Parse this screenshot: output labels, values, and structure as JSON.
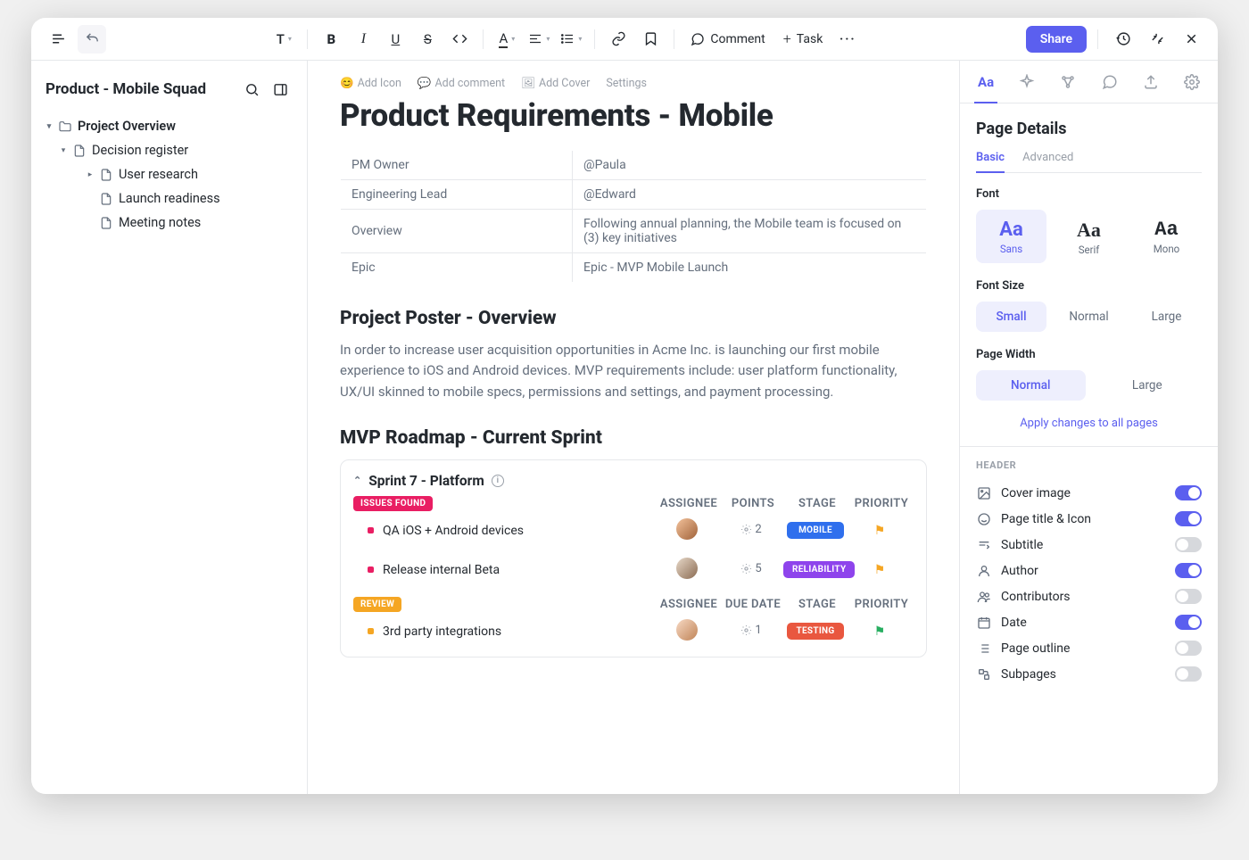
{
  "toolbar": {
    "typography_label": "T",
    "text_color_label": "A",
    "comment_label": "Comment",
    "task_label": "Task",
    "share_label": "Share"
  },
  "workspace": {
    "title": "Product - Mobile Squad"
  },
  "tree": [
    {
      "label": "Project Overview",
      "level": 0,
      "caret": "▾",
      "type": "folder"
    },
    {
      "label": "Decision register",
      "level": 1,
      "caret": "▾",
      "type": "page"
    },
    {
      "label": "User research",
      "level": 2,
      "caret": "▸",
      "type": "page"
    },
    {
      "label": "Launch readiness",
      "level": 2,
      "caret": "",
      "type": "page"
    },
    {
      "label": "Meeting notes",
      "level": 2,
      "caret": "",
      "type": "page"
    }
  ],
  "pageActions": {
    "addIcon": "Add Icon",
    "addComment": "Add comment",
    "addCover": "Add Cover",
    "settings": "Settings"
  },
  "page": {
    "title": "Product Requirements - Mobile",
    "meta": [
      {
        "k": "PM Owner",
        "v": "@Paula"
      },
      {
        "k": "Engineering Lead",
        "v": "@Edward"
      },
      {
        "k": "Overview",
        "v": "Following annual planning, the Mobile team is focused on (3) key initiatives"
      },
      {
        "k": "Epic",
        "v": "Epic - MVP Mobile Launch"
      }
    ],
    "poster_heading": "Project Poster - Overview",
    "poster_body": "In order to increase user acquisition opportunities in Acme Inc. is launching our first mobile experience to iOS and Android devices. MVP requirements include: user platform functionality, UX/UI skinned to mobile specs, permissions and settings, and payment processing.",
    "roadmap_heading": "MVP Roadmap - Current Sprint"
  },
  "sprint": {
    "title": "Sprint  7 - Platform",
    "groups": [
      {
        "label": "ISSUES FOUND",
        "labelClass": "issues",
        "columns": [
          "ASSIGNEE",
          "POINTS",
          "STAGE",
          "PRIORITY"
        ],
        "tasks": [
          {
            "dot": "pink",
            "name": "QA iOS + Android devices",
            "avatar": "a1",
            "points": "2",
            "stage": "MOBILE",
            "stageClass": "mobile",
            "flag": "y"
          },
          {
            "dot": "pink",
            "name": "Release internal Beta",
            "avatar": "a2",
            "points": "5",
            "stage": "RELIABILITY",
            "stageClass": "reliability",
            "flag": "y"
          }
        ]
      },
      {
        "label": "REVIEW",
        "labelClass": "review",
        "columns": [
          "ASSIGNEE",
          "DUE DATE",
          "STAGE",
          "PRIORITY"
        ],
        "tasks": [
          {
            "dot": "yellow",
            "name": "3rd party integrations",
            "avatar": "a3",
            "points": "1",
            "stage": "TESTING",
            "stageClass": "testing",
            "flag": "g"
          }
        ]
      }
    ]
  },
  "rpanel": {
    "title": "Page Details",
    "tabs": {
      "basic": "Basic",
      "advanced": "Advanced"
    },
    "font_label": "Font",
    "fonts": [
      {
        "name": "Sans",
        "cls": "sans",
        "active": true
      },
      {
        "name": "Serif",
        "cls": "serif",
        "active": false
      },
      {
        "name": "Mono",
        "cls": "mono",
        "active": false
      }
    ],
    "size_label": "Font Size",
    "sizes": [
      {
        "name": "Small",
        "active": true
      },
      {
        "name": "Normal",
        "active": false
      },
      {
        "name": "Large",
        "active": false
      }
    ],
    "width_label": "Page Width",
    "widths": [
      {
        "name": "Normal",
        "active": true
      },
      {
        "name": "Large",
        "active": false
      }
    ],
    "apply_all": "Apply changes to all pages",
    "header_label": "HEADER",
    "toggles": [
      {
        "icon": "image",
        "label": "Cover image",
        "on": true
      },
      {
        "icon": "smile",
        "label": "Page title & Icon",
        "on": true
      },
      {
        "icon": "subtitle",
        "label": "Subtitle",
        "on": false
      },
      {
        "icon": "user",
        "label": "Author",
        "on": true
      },
      {
        "icon": "users",
        "label": "Contributors",
        "on": false
      },
      {
        "icon": "calendar",
        "label": "Date",
        "on": true
      },
      {
        "icon": "outline",
        "label": "Page outline",
        "on": false
      },
      {
        "icon": "subpages",
        "label": "Subpages",
        "on": false
      }
    ]
  }
}
